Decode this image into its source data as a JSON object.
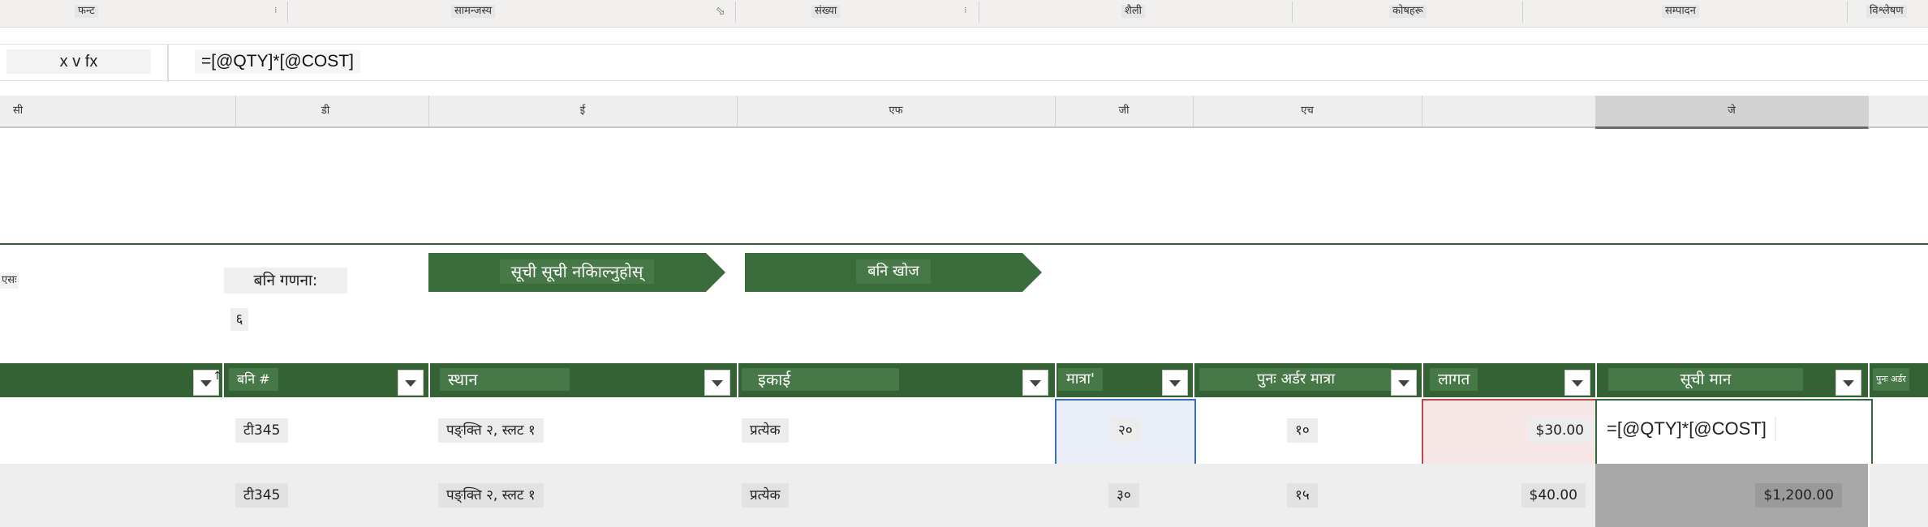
{
  "ribbon": {
    "groups": [
      "फन्ट",
      "सामन्जस्य",
      "संख्या",
      "शैली",
      "कोषहरू",
      "सम्पादन",
      "विश्लेषण"
    ]
  },
  "formula_bar": {
    "name_box": "x v fx",
    "formula": "=[@QTY]*[@COST]"
  },
  "columns": [
    "सी",
    "डी",
    "ई",
    "एफ",
    "जी",
    "एच",
    "",
    "जे"
  ],
  "selected_column": "जे",
  "controls": {
    "row_label": "एसः",
    "count_label": "बनि गणना:",
    "count_value": "६",
    "list_button": "सूची सूची नकिाल्नुहोस्",
    "search_button": "बनि खोज"
  },
  "table": {
    "headers": [
      "",
      "बनि #",
      "स्थान",
      "इकाई",
      "मात्रा'",
      "पुनः अर्डर मात्रा",
      "लागत",
      "सूची मान",
      "पुनः अर्डर"
    ],
    "rows": [
      {
        "bin": "टी345",
        "location": "पङ्क्ति २, स्लट १",
        "unit": "प्रत्येक",
        "qty": "२०",
        "reorder": "१०",
        "cost": "$30.00",
        "value": "=[@QTY]*[@COST]"
      },
      {
        "bin": "टी345",
        "location": "पङ्क्ति २, स्लट १",
        "unit": "प्रत्येक",
        "qty": "३०",
        "reorder": "१५",
        "cost": "$40.00",
        "value": "$1,200.00"
      }
    ]
  },
  "colors": {
    "header_green": "#356235",
    "button_green": "#3a6b3a",
    "qty_edit_border": "#3d6fb5",
    "cost_edit_border": "#b94a4a",
    "active_cell_border": "#2f6a3e"
  }
}
